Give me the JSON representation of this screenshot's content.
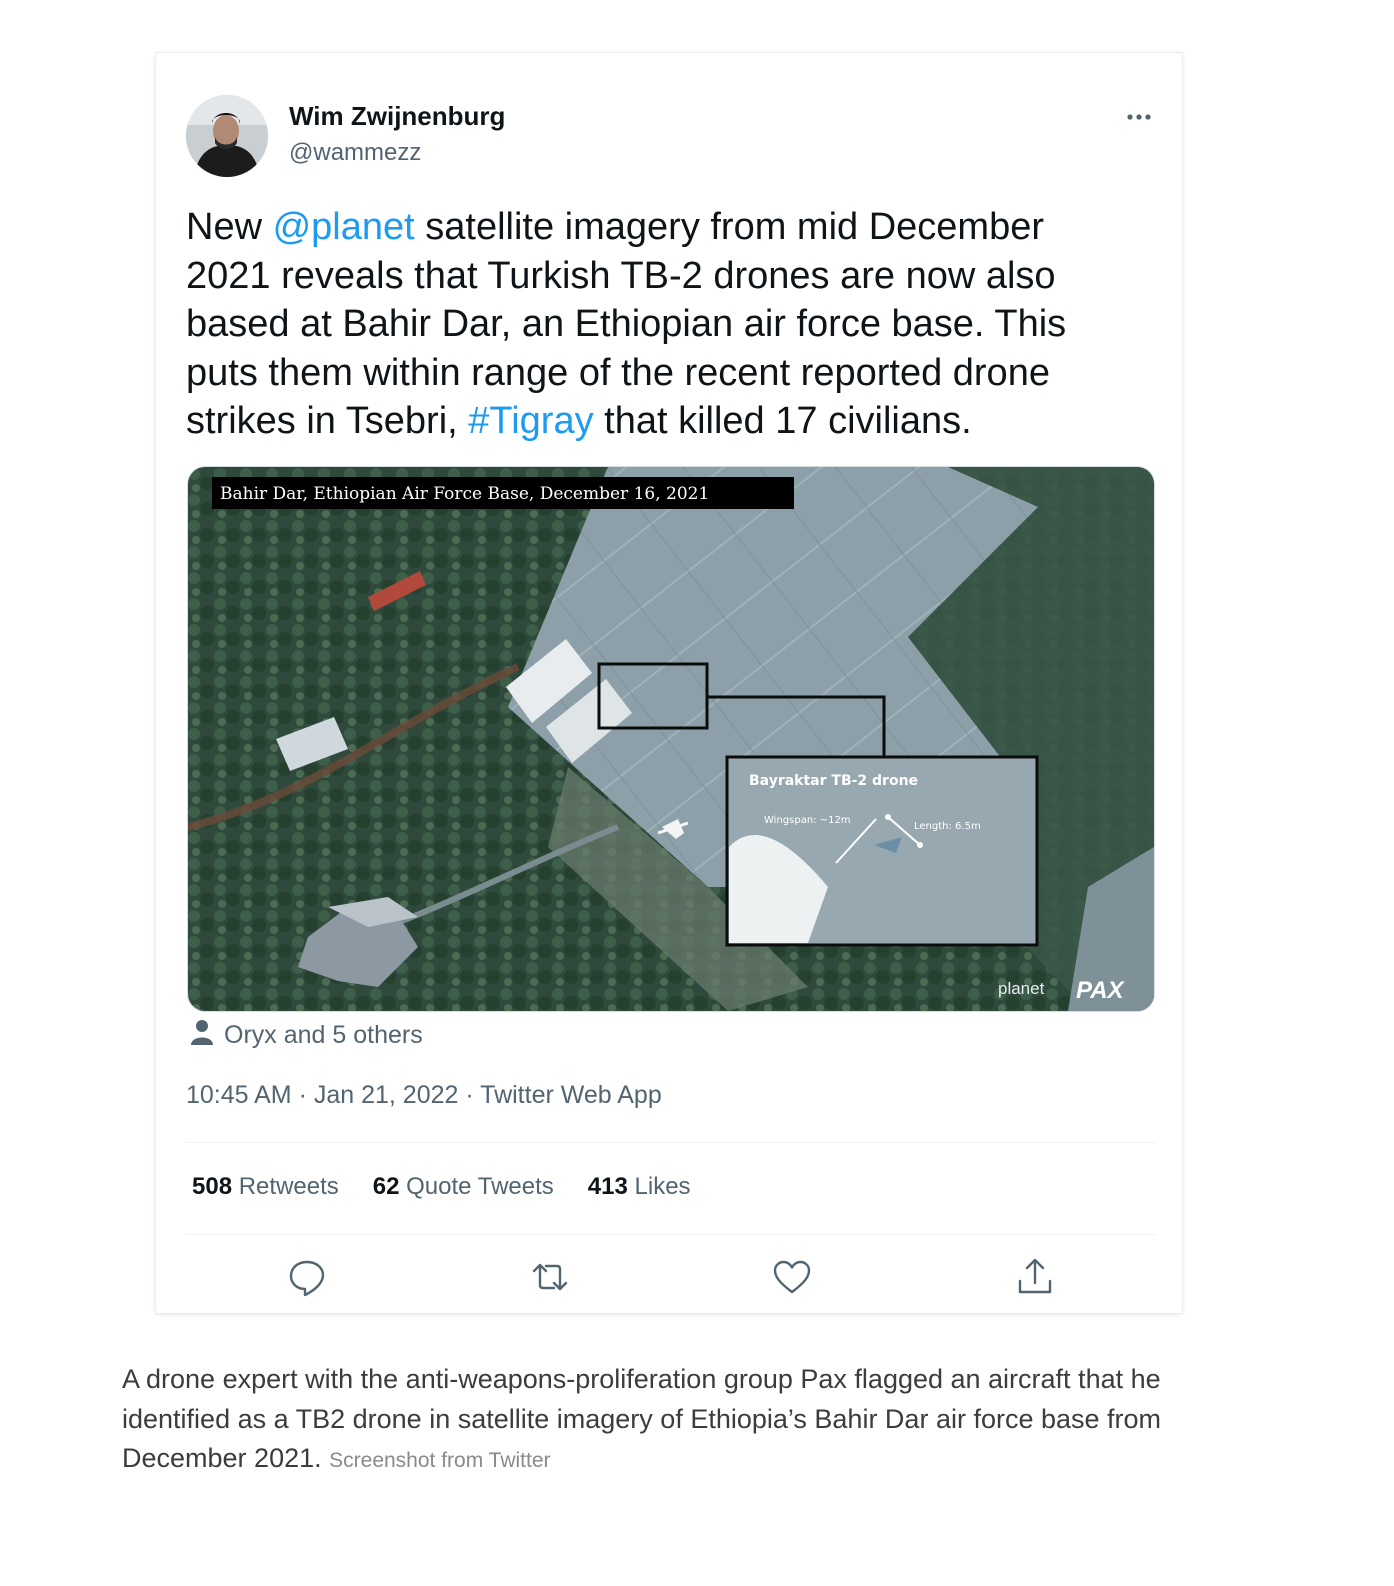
{
  "tweet": {
    "author_name": "Wim Zwijnenburg",
    "author_handle": "@wammezz",
    "text_parts": {
      "p1": "New ",
      "mention": "@planet",
      "p2": " satellite imagery from mid December 2021 reveals that Turkish TB-2 drones are now also based at Bahir Dar, an Ethiopian air force base. This puts them within range of the recent reported drone strikes in Tsebri, ",
      "hashtag": "#Tigray",
      "p3": " that killed 17 civilians."
    },
    "image": {
      "title_banner": "Bahir Dar, Ethiopian Air Force Base, December 16, 2021",
      "inset_title": "Bayraktar TB-2 drone",
      "wingspan_label": "Wingspan: ~12m",
      "length_label": "Length: 6.5m",
      "watermark_planet": "planet",
      "watermark_pax": "PAX"
    },
    "tagged_people": "Oryx and 5 others",
    "timestamp": "10:45 AM · Jan 21, 2022 · Twitter Web App",
    "stats": {
      "retweets_count": "508",
      "retweets_label": "Retweets",
      "quotes_count": "62",
      "quotes_label": "Quote Tweets",
      "likes_count": "413",
      "likes_label": "Likes"
    },
    "action_icons": [
      "reply-icon",
      "retweet-icon",
      "like-icon",
      "share-icon"
    ]
  },
  "caption": {
    "text": "A drone expert with the anti-weapons-proliferation group Pax flagged an aircraft that he identified as a TB2 drone in satellite imagery of Ethiopia’s Bahir Dar air force base from December 2021.",
    "credit": "Screenshot from Twitter"
  },
  "colors": {
    "link": "#1d9bf0",
    "secondary_text": "#536471",
    "primary_text": "#0f1419"
  }
}
